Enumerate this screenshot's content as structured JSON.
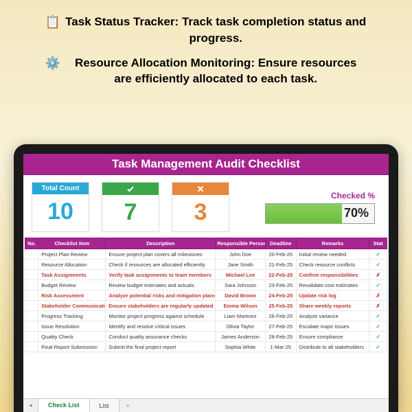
{
  "promo": {
    "line1_icon": "📋",
    "line1_bold": "Task Status Tracker:",
    "line1_rest": "Track task completion status and progress.",
    "line2_icon": "⚙️",
    "line2_bold": "Resource Allocation Monitoring:",
    "line2_rest": "Ensure resources are efficiently allocated to each task."
  },
  "sheet": {
    "title": "Task Management Audit Checklist",
    "stats": {
      "total_label": "Total Count",
      "total_value": "10",
      "pass_value": "7",
      "fail_value": "3",
      "checked_label": "Checked %",
      "checked_pct": "70%",
      "checked_fill": 70
    },
    "columns": {
      "no": "No.",
      "item": "Checklist Item",
      "desc": "Description",
      "person": "Responsible Person",
      "deadline": "Deadline",
      "remarks": "Remarks",
      "status": "Stat"
    },
    "rows": [
      {
        "no": "",
        "item": "Project Plan Review",
        "desc": "Ensure project plan covers all milestones",
        "person": "John Doe",
        "deadline": "20-Feb-25",
        "remarks": "Initial review needed",
        "status": "ok",
        "flag": false
      },
      {
        "no": "",
        "item": "Resource Allocation",
        "desc": "Check if resources are allocated efficiently",
        "person": "Jane Smith",
        "deadline": "21-Feb-25",
        "remarks": "Check resource conflicts",
        "status": "ok",
        "flag": false
      },
      {
        "no": "",
        "item": "Task Assignments",
        "desc": "Verify task assignments to team members",
        "person": "Michael Lee",
        "deadline": "22-Feb-25",
        "remarks": "Confirm responsibilities",
        "status": "bad",
        "flag": true
      },
      {
        "no": "",
        "item": "Budget Review",
        "desc": "Review budget estimates and actuals",
        "person": "Sara Johnson",
        "deadline": "23-Feb-25",
        "remarks": "Revalidate cost estimates",
        "status": "ok",
        "flag": false
      },
      {
        "no": "",
        "item": "Risk Assessment",
        "desc": "Analyze potential risks and mitigation plans",
        "person": "David Brown",
        "deadline": "24-Feb-25",
        "remarks": "Update risk log",
        "status": "bad",
        "flag": true
      },
      {
        "no": "",
        "item": "Stakeholder Communication",
        "desc": "Ensure stakeholders are regularly updated",
        "person": "Emma Wilson",
        "deadline": "25-Feb-25",
        "remarks": "Share weekly reports",
        "status": "bad",
        "flag": true
      },
      {
        "no": "",
        "item": "Progress Tracking",
        "desc": "Monitor project progress against schedule",
        "person": "Liam Martinez",
        "deadline": "26-Feb-25",
        "remarks": "Analyze variance",
        "status": "ok",
        "flag": false
      },
      {
        "no": "",
        "item": "Issue Resolution",
        "desc": "Identify and resolve critical issues",
        "person": "Olivia Taylor",
        "deadline": "27-Feb-25",
        "remarks": "Escalate major issues",
        "status": "ok",
        "flag": false
      },
      {
        "no": "",
        "item": "Quality Check",
        "desc": "Conduct quality assurance checks",
        "person": "James Anderson",
        "deadline": "28-Feb-25",
        "remarks": "Ensure compliance",
        "status": "ok",
        "flag": false
      },
      {
        "no": "",
        "item": "Final Report Submission",
        "desc": "Submit the final project report",
        "person": "Sophia White",
        "deadline": "1-Mar-25",
        "remarks": "Distribute to all stakeholders",
        "status": "ok",
        "flag": false
      }
    ],
    "tabs": {
      "active": "Check List",
      "other": "List",
      "add": "+"
    }
  }
}
